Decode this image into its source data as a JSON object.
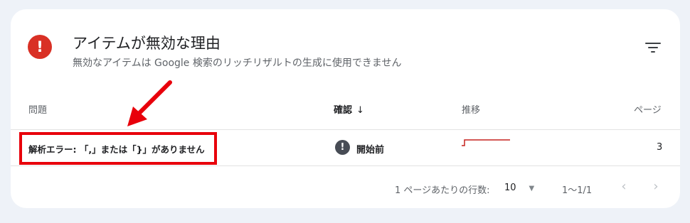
{
  "header": {
    "error_icon_name": "error-exclamation-icon",
    "error_glyph": "!",
    "title": "アイテムが無効な理由",
    "subtitle": "無効なアイテムは Google 検索のリッチリザルトの生成に使用できません"
  },
  "table": {
    "columns": [
      "問題",
      "確認",
      "推移",
      "ページ"
    ],
    "sort_indicator": "↓",
    "rows": [
      {
        "issue": "解析エラー: 「,」または「}」がありません",
        "status_icon": "!",
        "status": "開始前",
        "pages": "3"
      }
    ]
  },
  "pagination": {
    "rows_per_page_label": "1 ページあたりの行数:",
    "rows_per_page_value": "10",
    "range": "1〜1/1",
    "prev_glyph": "‹",
    "next_glyph": "›"
  },
  "colors": {
    "error_red": "#d93025",
    "highlight_red": "#e8000b",
    "card_bg": "#ffffff",
    "page_bg": "#eef2f8"
  }
}
